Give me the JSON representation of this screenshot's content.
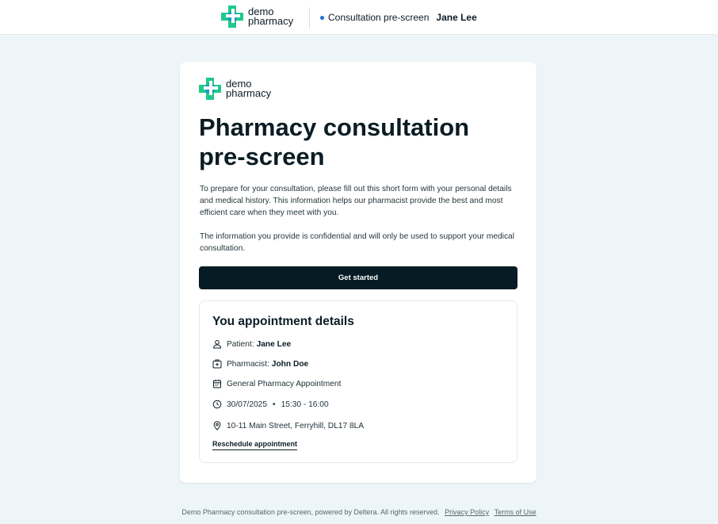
{
  "brand": {
    "name_line1": "demo",
    "name_line2": "pharmacy",
    "colors": {
      "primary_green": "#1fc98a",
      "secondary_blue": "#1d8fd8",
      "dark": "#061b24"
    }
  },
  "topbar": {
    "status_label": "Consultation pre-screen",
    "status_color": "#1a6fd8",
    "patient_name": "Jane Lee"
  },
  "main": {
    "title": "Pharmacy consultation pre-screen",
    "intro_p1": "To prepare for your consultation, please fill out this short form with your personal details and medical history. This information helps our pharmacist provide the best and most efficient care when they meet with you.",
    "intro_p2": "The information you provide is confidential and will only be used to support your medical consultation.",
    "cta_label": "Get started"
  },
  "appointment": {
    "heading": "You appointment details",
    "patient_label": "Patient:",
    "patient_name": "Jane Lee",
    "pharmacist_label": "Pharmacist:",
    "pharmacist_name": "John Doe",
    "service": "General Pharmacy Appointment",
    "date": "30/07/2025",
    "separator": "•",
    "time": "15:30 - 16:00",
    "address": "10-11 Main Street, Ferryhill, DL17 8LA",
    "reschedule_label": "Reschedule appointment",
    "icons": [
      "user-icon",
      "pharmacist-badge-icon",
      "calendar-icon",
      "clock-icon",
      "location-pin-icon"
    ]
  },
  "footer": {
    "text": "Demo Pharmacy consultation pre-screen, powered by Deltera. All rights reserved.",
    "privacy_label": "Privacy Policy",
    "terms_label": "Terms of Use"
  }
}
